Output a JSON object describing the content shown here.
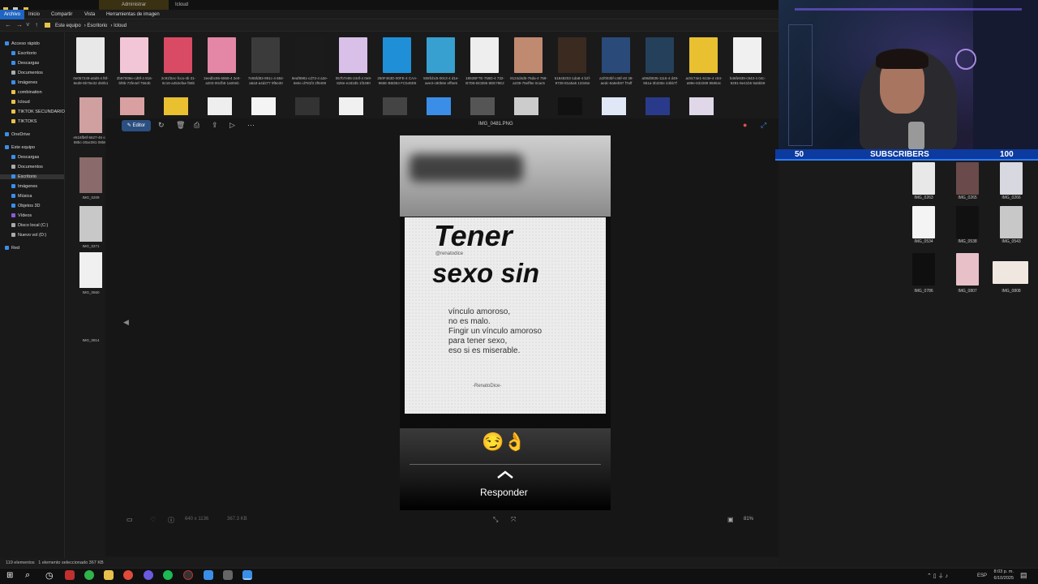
{
  "titlebar": {
    "tab_admin": "Administrar",
    "tab_icloud": "Icloud"
  },
  "ribbon": {
    "items": [
      "Archivo",
      "Inicio",
      "Compartir",
      "Vista",
      "Herramientas de imagen"
    ]
  },
  "breadcrumb": [
    "Este equipo",
    "Escritorio",
    "Icloud"
  ],
  "sidebar": [
    {
      "label": "Acceso rápido",
      "color": "#3b8ee8"
    },
    {
      "label": "Escritorio",
      "color": "#3b8ee8"
    },
    {
      "label": "Descargas",
      "color": "#3b8ee8"
    },
    {
      "label": "Documentos",
      "color": "#aaaaaa"
    },
    {
      "label": "Imágenes",
      "color": "#3b8ee8"
    },
    {
      "label": "combination",
      "color": "#e8c14a"
    },
    {
      "label": "Icloud",
      "color": "#e8c14a"
    },
    {
      "label": "TIKTOK SECUNDARIO",
      "color": "#e8c14a"
    },
    {
      "label": "TIKTOKS",
      "color": "#e8c14a"
    },
    {
      "label": "OneDrive",
      "color": "#3b8ee8"
    },
    {
      "label": "Este equipo",
      "color": "#3b8ee8"
    },
    {
      "label": "Descargas",
      "color": "#3b8ee8"
    },
    {
      "label": "Documentos",
      "color": "#aaaaaa"
    },
    {
      "label": "Escritorio",
      "color": "#3b8ee8"
    },
    {
      "label": "Imágenes",
      "color": "#3b8ee8"
    },
    {
      "label": "Música",
      "color": "#3b8ee8"
    },
    {
      "label": "Objetos 3D",
      "color": "#3b8ee8"
    },
    {
      "label": "Vídeos",
      "color": "#8a5cd8"
    },
    {
      "label": "Disco local (C:)",
      "color": "#aaaaaa"
    },
    {
      "label": "Nuevo vol (D:)",
      "color": "#aaaaaa"
    },
    {
      "label": "Red",
      "color": "#3b8ee8"
    }
  ],
  "top_thumbs": [
    {
      "label": "0e057249-a6d8-4 f6f-8ed9-9b76e32 d60b1",
      "color": "#e8e8e8"
    },
    {
      "label": "2b97008e-cd9f-4 816-bf9b-72fe4ef 7564b",
      "color": "#f2c6d6"
    },
    {
      "label": "2c91f2ec-fcca-4b 31-8c16-a452efae f66b",
      "color": "#d94a64"
    },
    {
      "label": "2eedbc86-6868-4 2e0-a203-00cfb8 1a00eb",
      "color": "#e486a6"
    },
    {
      "label": "7e55fd83-991c-4 684-a5a3-a4d277 9f5e30",
      "color": "#3b3b3b"
    },
    {
      "label": "9eaf9981-cd73-4 a2e-8e6c-d781f3 2f9409",
      "color": "#1b1b1b"
    },
    {
      "label": "057b7e95-244f-4 0e9-828e-e182d5 1f3490",
      "color": "#d8c0e8"
    },
    {
      "label": "250F463D-00FE-4 CAA-965E-B5DB4 FC549D5",
      "color": "#1f8fd8"
    },
    {
      "label": "506fcbc5-00c3-4 d1e-aee3-c80b8e eff5e5",
      "color": "#38a0d0"
    },
    {
      "label": "1892BF7E-759D-4 732-B7D8-BCB86 8DE79E2",
      "color": "#eeeeee"
    },
    {
      "label": "8124d4d5-76da-4 759-a239-75eff5e 0cac5",
      "color": "#c08a70"
    },
    {
      "label": "61848203-1da8-4 b2f-9728-81a5a5 13346e",
      "color": "#3a2a20"
    },
    {
      "label": "a1f003bf-c46f-40 38-aedc-6a5eb97 f7aff",
      "color": "#2a4a7a"
    },
    {
      "label": "a08d0835-1116-4 d49-951a-3b330e 24bb7f",
      "color": "#25405a"
    },
    {
      "label": "ac8c74e1-613e-4 c84-a99e-632289 95954c",
      "color": "#e8c030"
    },
    {
      "label": "b46fe939-c943-4 04c-9281-9e41b5 9a5bb9",
      "color": "#f0f0f0"
    }
  ],
  "left_thumbs": [
    {
      "label": "e516fb6f-5627-46 ce-88bc-20ac081 09b8a",
      "color": "#d0a0a0"
    },
    {
      "label": "IMG_0209",
      "color": "#8a6a6a"
    },
    {
      "label": "IMG_0271",
      "color": "#c8c8c8"
    },
    {
      "label": "IMG_0560",
      "color": "#f0f0f0"
    },
    {
      "label": "IMG_0814",
      "color": "#1a1a1a"
    }
  ],
  "viewer": {
    "editor_label": "Editor",
    "filename": "IMG_0481.PNG",
    "dimensions": "640 x 1136",
    "filesize": "367.3 KB",
    "zoom": "81%"
  },
  "story": {
    "title_line1": "Tener",
    "handle": "@renatodice",
    "title_line2": "sexo sin",
    "body": [
      "vínculo amoroso,",
      "no es malo.",
      "Fingir un vínculo amoroso",
      "para tener sexo,",
      "eso si es miserable."
    ],
    "signature": "-RenatoDice-",
    "emojis": "😏👌",
    "reply": "Responder"
  },
  "statusbar": {
    "count": "119 elementos",
    "selected": "1 elemento seleccionado",
    "size": "367 KB"
  },
  "overlay": {
    "left": "50",
    "middle": "SUBSCRIBERS",
    "right": "100"
  },
  "right_thumbs": [
    {
      "label": "IMG_0263",
      "color": "#e8e8e8"
    },
    {
      "label": "IMG_0265",
      "color": "#6a4a4a"
    },
    {
      "label": "IMG_0266",
      "color": "#d8d8e0"
    },
    {
      "label": "IMG_0534",
      "color": "#f4f4f4"
    },
    {
      "label": "IMG_0538",
      "color": "#111111"
    },
    {
      "label": "IMG_0543",
      "color": "#c8c8c8"
    },
    {
      "label": "IMG_0786",
      "color": "#0f0f0f"
    },
    {
      "label": "IMG_0807",
      "color": "#e8c0c8"
    },
    {
      "label": "IMG_0808",
      "color": "#f0e8e0"
    }
  ],
  "tray": {
    "lang": "ESP",
    "time": "8:03 p. m.",
    "date": "6/10/2025"
  }
}
